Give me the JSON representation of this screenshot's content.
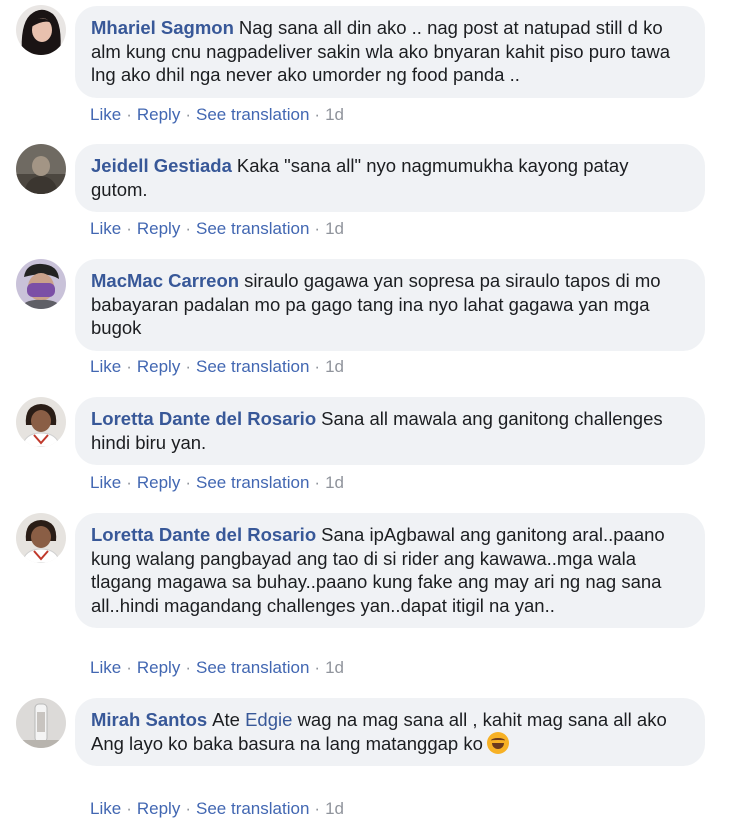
{
  "comments": [
    {
      "author": "Mhariel Sagmon",
      "text": "Nag sana all din ako .. nag post at natupad still d ko alm kung cnu nagpadeliver sakin wla ako bnyaran kahit piso puro tawa lng ako dhil nga never ako umorder ng food panda ..",
      "like": "Like",
      "reply": "Reply",
      "translate": "See translation",
      "time": "1d"
    },
    {
      "author": "Jeidell Gestiada",
      "text": "Kaka \"sana all\" nyo nagmumukha kayong patay gutom.",
      "like": "Like",
      "reply": "Reply",
      "translate": "See translation",
      "time": "1d"
    },
    {
      "author": "MacMac Carreon",
      "text": "siraulo gagawa yan sopresa pa siraulo tapos di mo babayaran padalan mo pa gago tang ina nyo lahat gagawa yan mga bugok",
      "like": "Like",
      "reply": "Reply",
      "translate": "See translation",
      "time": "1d"
    },
    {
      "author": "Loretta Dante del Rosario",
      "text": "Sana all mawala ang ganitong challenges hindi biru yan.",
      "like": "Like",
      "reply": "Reply",
      "translate": "See translation",
      "time": "1d"
    },
    {
      "author": "Loretta Dante del Rosario",
      "text": "Sana ipAgbawal ang ganitong aral..paano kung walang pangbayad ang tao di si rider ang kawawa..mga wala tlagang magawa sa buhay..paano kung fake ang may ari ng nag sana all..hindi magandang challenges yan..dapat itigil na yan..",
      "like": "Like",
      "reply": "Reply",
      "translate": "See translation",
      "time": "1d"
    },
    {
      "author": "Mirah Santos",
      "text_before": "Ate",
      "mention": "Edgie",
      "text_after": "wag na mag sana all , kahit mag sana all ako",
      "text_line2": "Ang layo ko baka basura na lang matanggap ko",
      "emoji": "rolling-on-floor-laughing-emoji",
      "like": "Like",
      "reply": "Reply",
      "translate": "See translation",
      "time": "1d"
    }
  ],
  "colors": {
    "author": "#385898",
    "action": "#4267b2",
    "meta": "#90949c",
    "bubble": "#f0f2f5"
  }
}
